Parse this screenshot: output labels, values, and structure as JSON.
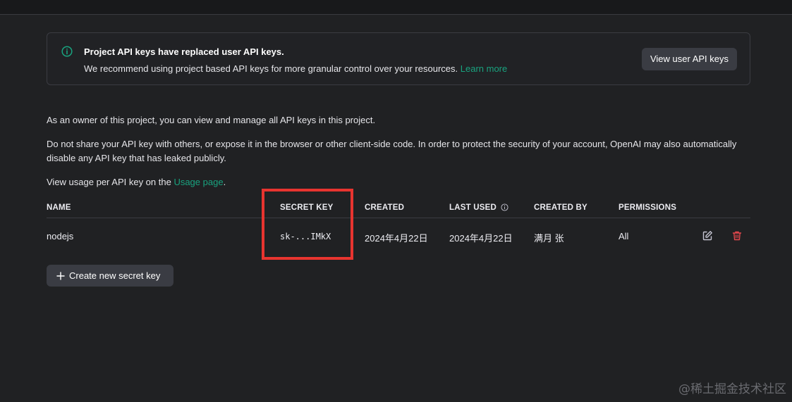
{
  "notice": {
    "title": "Project API keys have replaced user API keys.",
    "text": "We recommend using project based API keys for more granular control over your resources.",
    "link": "Learn more",
    "button": "View user API keys"
  },
  "paragraphs": {
    "p1": "As an owner of this project, you can view and manage all API keys in this project.",
    "p2": "Do not share your API key with others, or expose it in the browser or other client-side code. In order to protect the security of your account, OpenAI may also automatically disable any API key that has leaked publicly.",
    "p3_prefix": "View usage per API key on the ",
    "p3_link": "Usage page",
    "p3_suffix": "."
  },
  "table": {
    "headers": [
      "NAME",
      "SECRET KEY",
      "CREATED",
      "LAST USED",
      "CREATED BY",
      "PERMISSIONS"
    ],
    "rows": [
      {
        "name": "nodejs",
        "secret_key": "sk-...IMkX",
        "created": "2024年4月22日",
        "last_used": "2024年4月22日",
        "created_by": "满月 张",
        "permissions": "All"
      }
    ]
  },
  "create_button": "Create new secret key",
  "watermark": "@稀土掘金技术社区",
  "colors": {
    "background": "#202123",
    "accent": "#19a37f",
    "highlight": "#e8342f",
    "delete": "#e5484d"
  },
  "icons": [
    "info-circle-icon",
    "info-icon",
    "edit-icon",
    "trash-icon",
    "plus-icon"
  ]
}
